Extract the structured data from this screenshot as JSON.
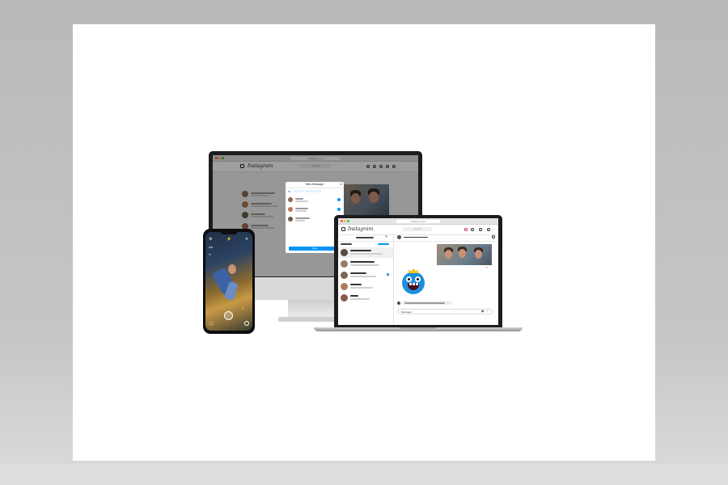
{
  "desktop": {
    "url": "instagram.com",
    "logo": "Instagram",
    "search_placeholder": "Search",
    "modal": {
      "title": "New Message",
      "to_label": "To:",
      "chips": [
        "",
        ""
      ],
      "next_label": "Next"
    }
  },
  "laptop": {
    "url": "instagram.com",
    "logo": "Instagram",
    "search_placeholder": "Search",
    "composer_placeholder": "Message...",
    "chat_title": "",
    "incoming_message": ""
  },
  "phone": {
    "modes": [
      "",
      "",
      ""
    ]
  },
  "colors": {
    "accent": "#0095f6",
    "device_frame": "#1c1c1e",
    "sticker": "#1b8fe0"
  }
}
